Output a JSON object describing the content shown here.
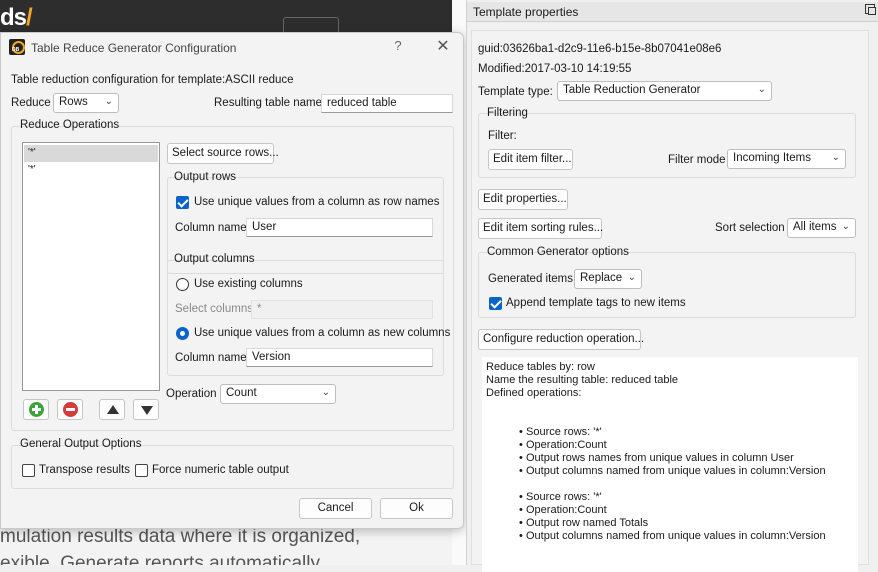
{
  "background": {
    "logo_text": "ds",
    "lines": [
      "mulation results data where it is organized,",
      "exible. Generate reports automatically"
    ]
  },
  "dialog": {
    "title": "Table Reduce Generator Configuration",
    "help_glyph": "?",
    "close_glyph": "✕",
    "config_label": "Table reduction configuration for template:ASCII reduce",
    "reduce_label": "Reduce",
    "reduce_value": "Rows",
    "result_name_label": "Resulting table name",
    "result_name_value": "reduced table",
    "ops_group_title": "Reduce Operations",
    "ops_items": [
      "'*'",
      "'*'"
    ],
    "select_rows_button": "Select source rows...",
    "output_rows": {
      "title": "Output rows",
      "use_unique_label": "Use unique values from a column as row names",
      "use_unique_checked": true,
      "column_name_label": "Column name",
      "column_name_value": "User"
    },
    "output_columns": {
      "title": "Output columns",
      "use_existing_label": "Use existing columns",
      "use_existing_selected": false,
      "select_columns_label": "Select columns",
      "select_columns_value": "*",
      "use_unique_label": "Use unique values from a column as new columns",
      "use_unique_selected": true,
      "column_name_label": "Column name",
      "column_name_value": "Version"
    },
    "operation_label": "Operation",
    "operation_value": "Count",
    "general_group_title": "General Output Options",
    "transpose_label": "Transpose results",
    "transpose_checked": false,
    "force_numeric_label": "Force numeric table output",
    "force_numeric_checked": false,
    "cancel_button": "Cancel",
    "ok_button": "Ok"
  },
  "template_properties": {
    "title": "Template properties",
    "guid": "guid:03626ba1-d2c9-11e6-b15e-8b07041e08e6",
    "modified": "Modified:2017-03-10 14:19:55",
    "template_type_label": "Template type:",
    "template_type_value": "Table Reduction Generator",
    "filtering_title": "Filtering",
    "filter_label": "Filter:",
    "edit_filter_button": "Edit item filter...",
    "filter_mode_label": "Filter mode",
    "filter_mode_value": "Incoming Items",
    "edit_properties_button": "Edit properties...",
    "edit_sorting_button": "Edit item sorting rules...",
    "sort_selection_label": "Sort selection",
    "sort_selection_value": "All items",
    "common_title": "Common Generator options",
    "generated_items_label": "Generated items",
    "generated_items_value": "Replace",
    "append_tags_label": "Append template tags to new items",
    "append_tags_checked": true,
    "configure_button": "Configure reduction operation...",
    "summary": {
      "line1": "Reduce tables by: row",
      "line2": "Name the resulting table: reduced table",
      "line3": "Defined operations:",
      "op1": [
        "Source rows: '*'",
        "Operation:Count",
        "Output rows names from unique values in column User",
        "Output columns named from unique values in column:Version"
      ],
      "op2": [
        "Source rows: '*'",
        "Operation:Count",
        "Output row named Totals",
        "Output columns named from unique values in column:Version"
      ]
    }
  }
}
